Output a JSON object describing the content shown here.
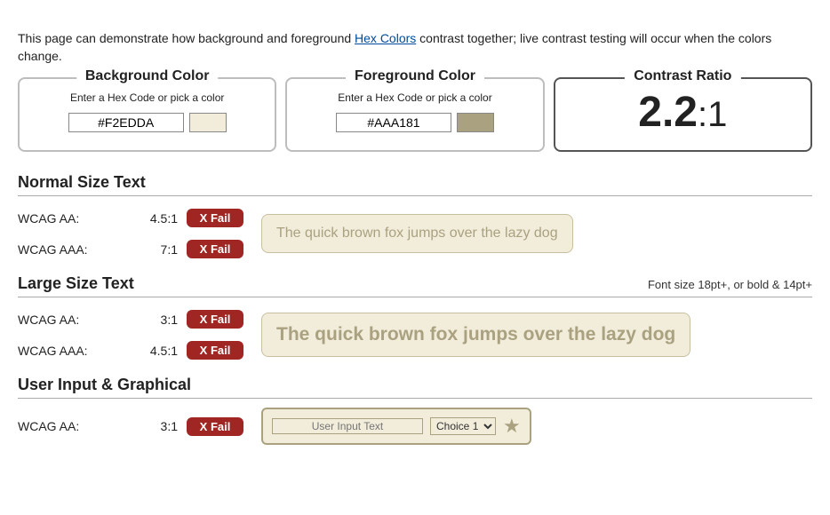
{
  "intro": {
    "before_link": "This page can demonstrate how background and foreground ",
    "link_text": "Hex Colors",
    "after_link": " contrast together; live contrast testing will occur when the colors change."
  },
  "background": {
    "legend": "Background Color",
    "hint": "Enter a Hex Code or pick a color",
    "value": "#F2EDDA",
    "swatch_color": "#F2EDDA"
  },
  "foreground": {
    "legend": "Foreground Color",
    "hint": "Enter a Hex Code or pick a color",
    "value": "#AAA181",
    "swatch_color": "#AAA181"
  },
  "ratio": {
    "legend": "Contrast Ratio",
    "value_main": "2.2",
    "value_suffix": ":1"
  },
  "normal": {
    "heading": "Normal Size Text",
    "aa_label": "WCAG AA:",
    "aa_req": "4.5:1",
    "aa_result": "X Fail",
    "aaa_label": "WCAG AAA:",
    "aaa_req": "7:1",
    "aaa_result": "X Fail",
    "sample": "The quick brown fox jumps over the lazy dog"
  },
  "large": {
    "heading": "Large Size Text",
    "note": "Font size 18pt+, or bold & 14pt+",
    "aa_label": "WCAG AA:",
    "aa_req": "3:1",
    "aa_result": "X Fail",
    "aaa_label": "WCAG AAA:",
    "aaa_req": "4.5:1",
    "aaa_result": "X Fail",
    "sample": "The quick brown fox jumps over the lazy dog"
  },
  "ui": {
    "heading": "User Input & Graphical",
    "aa_label": "WCAG AA:",
    "aa_req": "3:1",
    "aa_result": "X Fail",
    "placeholder": "User Input Text",
    "select_value": "Choice 1",
    "star": "★"
  }
}
